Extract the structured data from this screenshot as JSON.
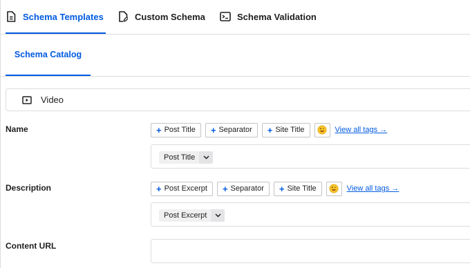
{
  "tabs": [
    {
      "label": "Schema Templates",
      "icon": "document-icon",
      "active": true
    },
    {
      "label": "Custom Schema",
      "icon": "document-edit-icon",
      "active": false
    },
    {
      "label": "Schema Validation",
      "icon": "terminal-icon",
      "active": false
    }
  ],
  "subtab": {
    "label": "Schema Catalog"
  },
  "schema_type": {
    "label": "Video",
    "icon": "video-icon"
  },
  "fields": {
    "name": {
      "label": "Name",
      "tags": [
        "Post Title",
        "Separator",
        "Site Title"
      ],
      "view_all": "View all tags →",
      "value_chip": "Post Title"
    },
    "description": {
      "label": "Description",
      "tags": [
        "Post Excerpt",
        "Separator",
        "Site Title"
      ],
      "view_all": "View all tags →",
      "value_chip": "Post Excerpt"
    },
    "content_url": {
      "label": "Content URL",
      "value": ""
    }
  },
  "colors": {
    "accent": "#005ae0",
    "border": "#dcdcde"
  }
}
